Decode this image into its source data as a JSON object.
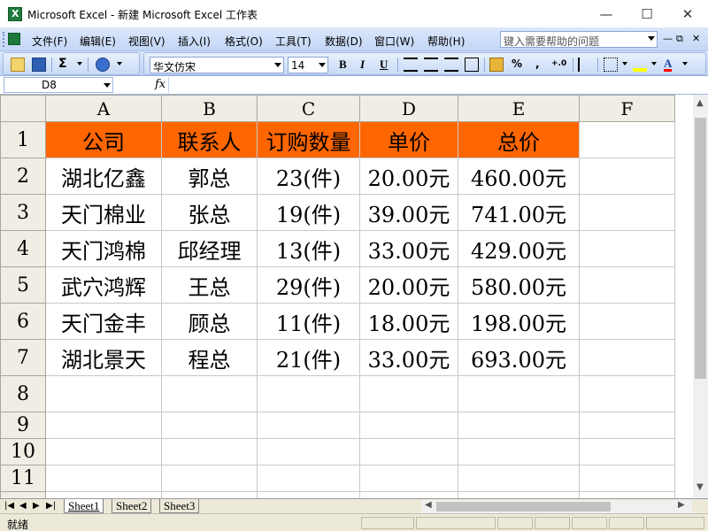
{
  "window": {
    "title": "Microsoft Excel - 新建 Microsoft Excel 工作表"
  },
  "menu": {
    "items": [
      "文件(F)",
      "编辑(E)",
      "视图(V)",
      "插入(I)",
      "格式(O)",
      "工具(T)",
      "数据(D)",
      "窗口(W)",
      "帮助(H)"
    ],
    "help_placeholder": "键入需要帮助的问题"
  },
  "toolbar": {
    "font_name": "华文仿宋",
    "font_size": "14",
    "bold": "B",
    "italic": "I",
    "underline": "U",
    "percent": "%",
    "comma": ",",
    "decimal": "+.0"
  },
  "formula_bar": {
    "name_box": "D8",
    "fx": "fx",
    "formula": ""
  },
  "columns": [
    "A",
    "B",
    "C",
    "D",
    "E",
    "F"
  ],
  "rows": [
    "1",
    "2",
    "3",
    "4",
    "5",
    "6",
    "7",
    "8",
    "9",
    "10",
    "11"
  ],
  "table": {
    "headers": [
      "公司",
      "联系人",
      "订购数量",
      "单价",
      "总价"
    ],
    "data": [
      [
        "湖北亿鑫",
        "郭总",
        "23(件)",
        "20.00元",
        "460.00元"
      ],
      [
        "天门棉业",
        "张总",
        "19(件)",
        "39.00元",
        "741.00元"
      ],
      [
        "天门鸿棉",
        "邱经理",
        "13(件)",
        "33.00元",
        "429.00元"
      ],
      [
        "武穴鸿辉",
        "王总",
        "29(件)",
        "20.00元",
        "580.00元"
      ],
      [
        "天门金丰",
        "顾总",
        "11(件)",
        "18.00元",
        "198.00元"
      ],
      [
        "湖北景天",
        "程总",
        "21(件)",
        "33.00元",
        "693.00元"
      ]
    ]
  },
  "sheet_tabs": [
    "Sheet1",
    "Sheet2",
    "Sheet3"
  ],
  "status": {
    "text": "就绪"
  },
  "colors": {
    "header_fill": "#ff6600",
    "menu_bg": "#c3d6f5",
    "grid_line": "#c9c9c9"
  }
}
